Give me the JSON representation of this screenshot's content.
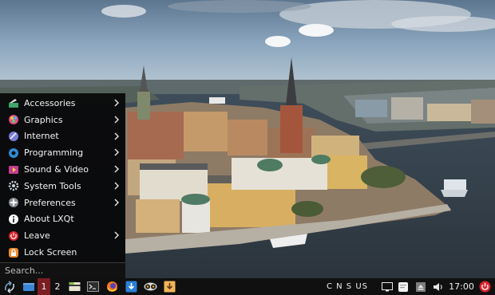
{
  "menu": {
    "items": [
      {
        "label": "Accessories",
        "icon": "accessories-icon",
        "submenu": true
      },
      {
        "label": "Graphics",
        "icon": "graphics-icon",
        "submenu": true
      },
      {
        "label": "Internet",
        "icon": "internet-icon",
        "submenu": true
      },
      {
        "label": "Programming",
        "icon": "programming-icon",
        "submenu": true
      },
      {
        "label": "Sound & Video",
        "icon": "sound-video-icon",
        "submenu": true
      },
      {
        "label": "System Tools",
        "icon": "system-tools-icon",
        "submenu": true
      },
      {
        "label": "Preferences",
        "icon": "preferences-icon",
        "submenu": true
      },
      {
        "label": "About LXQt",
        "icon": "info-icon",
        "submenu": false
      },
      {
        "label": "Leave",
        "icon": "leave-icon",
        "submenu": true
      },
      {
        "label": "Lock Screen",
        "icon": "lock-screen-icon",
        "submenu": false
      }
    ],
    "search_placeholder": "Search..."
  },
  "taskbar": {
    "workspaces": [
      "1",
      "2"
    ],
    "active_workspace": "1",
    "keyboard_layout": "C N S US",
    "clock": "17:00"
  },
  "colors": {
    "menu_bg": "#08080a",
    "taskbar_bg": "#101010",
    "active_workspace": "#7a1e22",
    "accent_red": "#d9232b"
  }
}
